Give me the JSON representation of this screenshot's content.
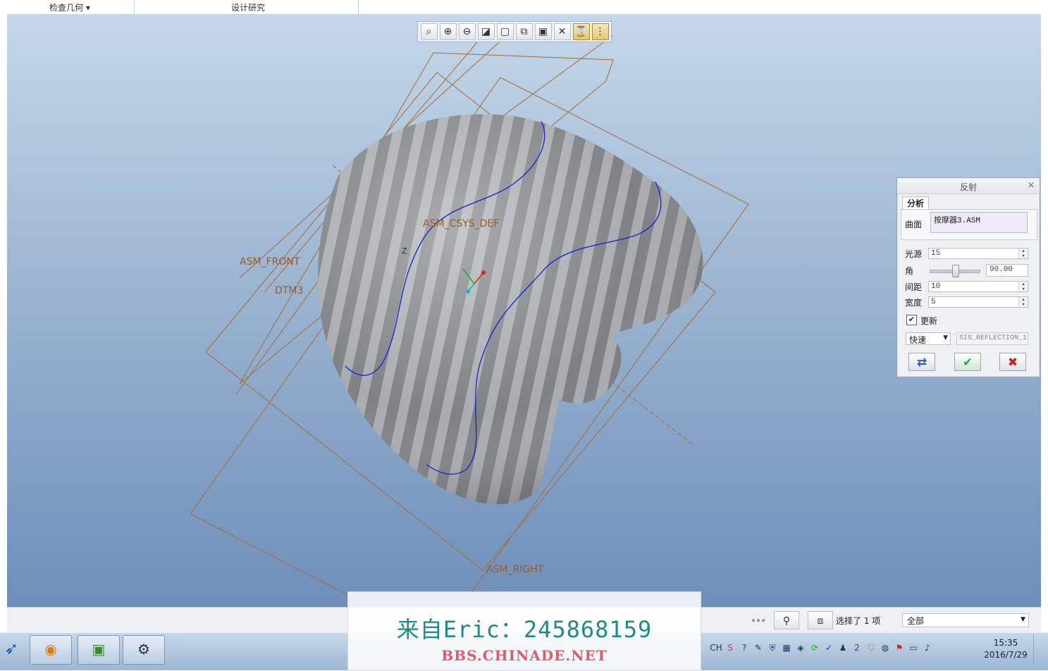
{
  "top_tabs": [
    "检查几何 ▾",
    "设计研究"
  ],
  "view_toolbar": {
    "buttons": [
      {
        "name": "refit-icon",
        "glyph": "⌕"
      },
      {
        "name": "zoom-in-icon",
        "glyph": "⊕"
      },
      {
        "name": "zoom-out-icon",
        "glyph": "⊖"
      },
      {
        "name": "repaint-icon",
        "glyph": "◪"
      },
      {
        "name": "display-style-icon",
        "glyph": "▢"
      },
      {
        "name": "saved-views-icon",
        "glyph": "⧉"
      },
      {
        "name": "view-manager-icon",
        "glyph": "▣"
      },
      {
        "name": "datum-display-icon",
        "glyph": "✕"
      },
      {
        "name": "spin-center-icon",
        "glyph": "⌛"
      },
      {
        "name": "annotation-display-icon",
        "glyph": "⋮"
      }
    ]
  },
  "datum_labels": {
    "csys": "ASM_CSYS_DEF",
    "front": "ASM_FRONT",
    "dtm3": "DTM3",
    "right": "ASM_RIGHT",
    "z_axis": "Z"
  },
  "dialog": {
    "title": "反射",
    "tab": "分析",
    "surface_label": "曲面",
    "surface_value": "按摩器3.ASM",
    "light_label": "光源",
    "light_value": "15",
    "angle_label": "角",
    "angle_value": "90.00",
    "spacing_label": "间距",
    "spacing_value": "10",
    "width_label": "宽度",
    "width_value": "5",
    "update_label": "更新",
    "update_checked": true,
    "mode_value": "快速",
    "analysis_name": "SIS_REFLECTION_1",
    "buttons": {
      "repeat": "⇄",
      "ok": "✔",
      "cancel": "✖"
    }
  },
  "status": {
    "selection_text": "选择了 1 项",
    "filter_value": "全部"
  },
  "watermark": {
    "line1": "来自Eric：245868159",
    "line2": "BBS.CHINADE.NET"
  },
  "taskbar": {
    "tray_lang": "CH",
    "time": "15:35",
    "date": "2016/7/29"
  },
  "colors": {
    "datum": "#9a5a2a",
    "curve": "#1a22c8",
    "ok_green": "#1fae3a",
    "cancel_red": "#c8201c"
  }
}
